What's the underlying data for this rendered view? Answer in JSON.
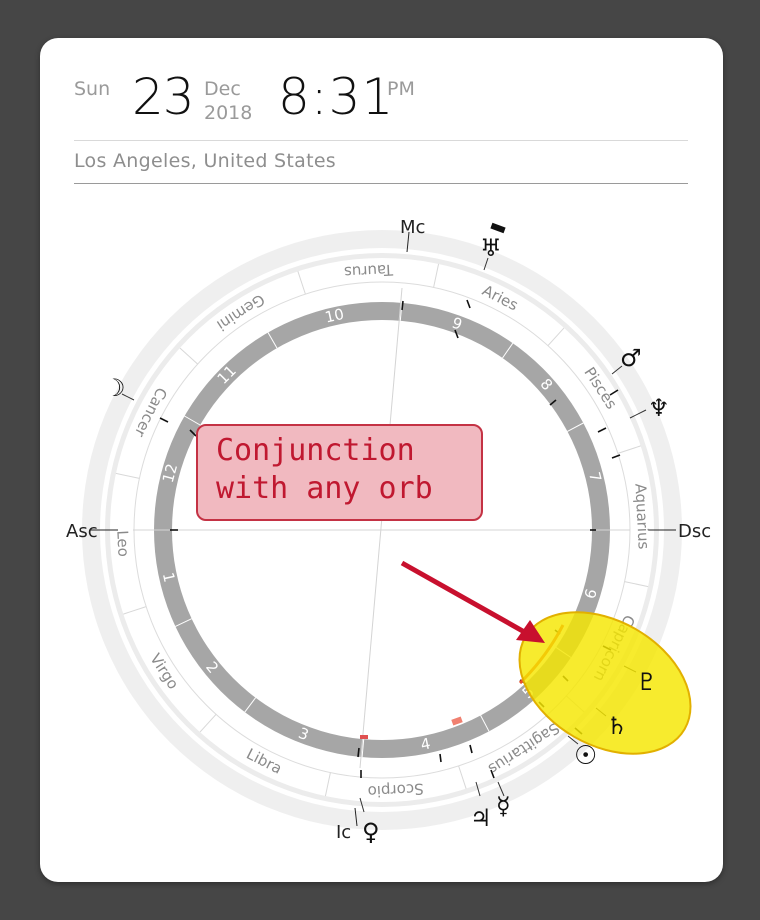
{
  "header": {
    "weekday": "Sun",
    "day": "23",
    "month": "Dec",
    "year": "2018",
    "time": "8:31",
    "ampm": "PM",
    "location": "Los Angeles, United States"
  },
  "chart": {
    "angles": {
      "asc": "Asc",
      "mc": "Mc",
      "dsc": "Dsc",
      "ic": "Ic"
    },
    "signs": [
      "Leo",
      "Cancer",
      "Gemini",
      "Taurus",
      "Aries",
      "Pisces",
      "Aquarius",
      "Capricorn",
      "Sagittarius",
      "Scorpio",
      "Libra",
      "Virgo"
    ],
    "houses": [
      "1",
      "2",
      "3",
      "4",
      "5",
      "6",
      "7",
      "8",
      "9",
      "10",
      "11",
      "12"
    ],
    "planets": {
      "moon": "☽",
      "uranus": "♅",
      "mars": "♂",
      "neptune": "♆",
      "pluto": "♇",
      "saturn": "♄",
      "sun": "☉",
      "mercury": "☿",
      "jupiter": "♃",
      "venus": "♀"
    },
    "colors": {
      "highlight": "#f5e600",
      "aspect": "#e8502a",
      "house_ring": "#a6a6a6"
    }
  },
  "annotation": {
    "text": "Conjunction\nwith any orb",
    "fill": "#f1b9c0",
    "border": "#c43244",
    "arrow": "#c8102e"
  }
}
